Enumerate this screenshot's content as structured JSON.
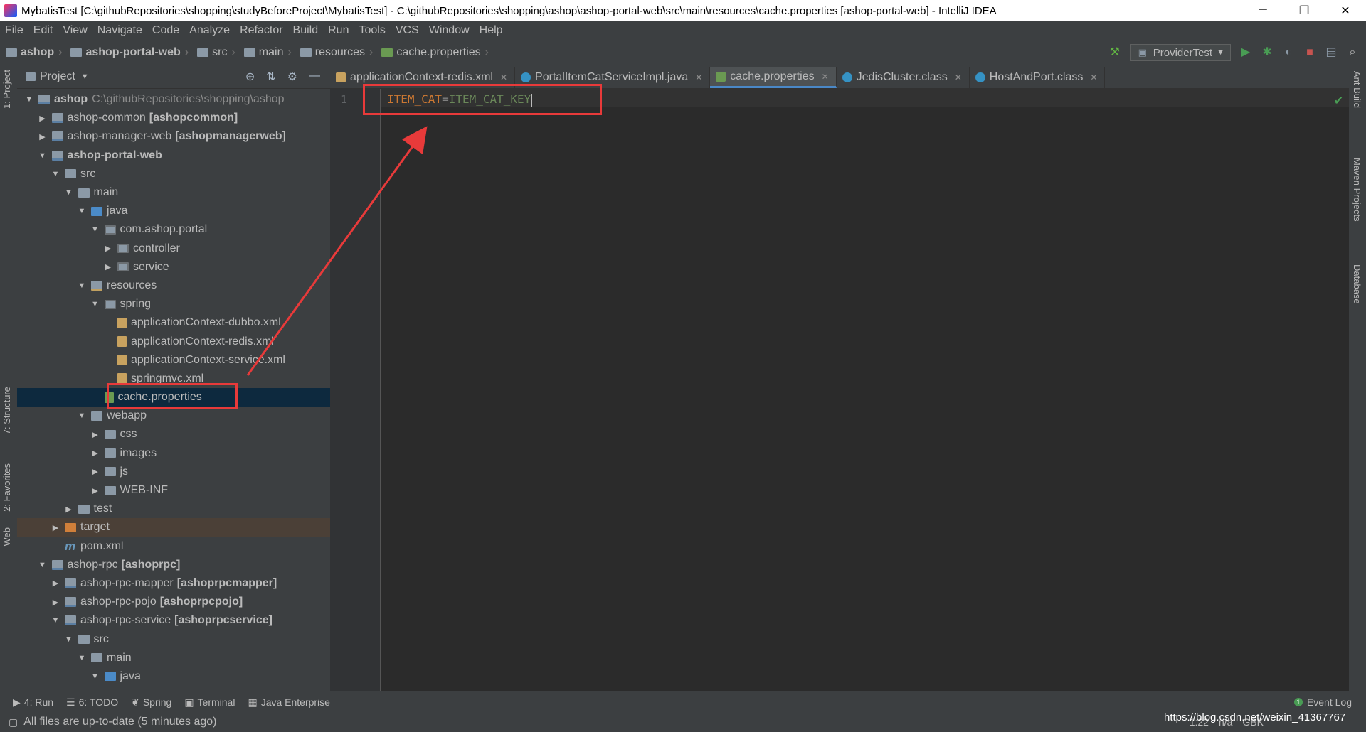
{
  "window": {
    "title": "MybatisTest [C:\\githubRepositories\\shopping\\studyBeforeProject\\MybatisTest] - C:\\githubRepositories\\shopping\\ashop\\ashop-portal-web\\src\\main\\resources\\cache.properties [ashop-portal-web] - IntelliJ IDEA",
    "minimize": "─",
    "restore": "❐",
    "close": "✕"
  },
  "menu": [
    "File",
    "Edit",
    "View",
    "Navigate",
    "Code",
    "Analyze",
    "Refactor",
    "Build",
    "Run",
    "Tools",
    "VCS",
    "Window",
    "Help"
  ],
  "breadcrumb": [
    "ashop",
    "ashop-portal-web",
    "src",
    "main",
    "resources",
    "cache.properties"
  ],
  "run_config": "ProviderTest",
  "project_panel": {
    "title": "Project",
    "tree": [
      {
        "label": "ashop",
        "path": "C:\\githubRepositories\\shopping\\ashop",
        "bold": true,
        "depth": 0,
        "arrow": "open",
        "icon": "module"
      },
      {
        "label": "ashop-common",
        "tag": "[ashopcommon]",
        "depth": 1,
        "arrow": "closed",
        "icon": "module"
      },
      {
        "label": "ashop-manager-web",
        "tag": "[ashopmanagerweb]",
        "depth": 1,
        "arrow": "closed",
        "icon": "module"
      },
      {
        "label": "ashop-portal-web",
        "bold": true,
        "depth": 1,
        "arrow": "open",
        "icon": "module"
      },
      {
        "label": "src",
        "depth": 2,
        "arrow": "open",
        "icon": "folder"
      },
      {
        "label": "main",
        "depth": 3,
        "arrow": "open",
        "icon": "folder"
      },
      {
        "label": "java",
        "depth": 4,
        "arrow": "open",
        "icon": "src"
      },
      {
        "label": "com.ashop.portal",
        "depth": 5,
        "arrow": "open",
        "icon": "pkg"
      },
      {
        "label": "controller",
        "depth": 6,
        "arrow": "closed",
        "icon": "pkg"
      },
      {
        "label": "service",
        "depth": 6,
        "arrow": "closed",
        "icon": "pkg"
      },
      {
        "label": "resources",
        "depth": 4,
        "arrow": "open",
        "icon": "res"
      },
      {
        "label": "spring",
        "depth": 5,
        "arrow": "open",
        "icon": "pkg"
      },
      {
        "label": "applicationContext-dubbo.xml",
        "depth": 6,
        "arrow": "none",
        "icon": "xml"
      },
      {
        "label": "applicationContext-redis.xml",
        "depth": 6,
        "arrow": "none",
        "icon": "xml"
      },
      {
        "label": "applicationContext-service.xml",
        "depth": 6,
        "arrow": "none",
        "icon": "xml"
      },
      {
        "label": "springmvc.xml",
        "depth": 6,
        "arrow": "none",
        "icon": "xml"
      },
      {
        "label": "cache.properties",
        "depth": 5,
        "arrow": "none",
        "icon": "props",
        "selected": true
      },
      {
        "label": "webapp",
        "depth": 4,
        "arrow": "open",
        "icon": "folder"
      },
      {
        "label": "css",
        "depth": 5,
        "arrow": "closed",
        "icon": "folder"
      },
      {
        "label": "images",
        "depth": 5,
        "arrow": "closed",
        "icon": "folder"
      },
      {
        "label": "js",
        "depth": 5,
        "arrow": "closed",
        "icon": "folder"
      },
      {
        "label": "WEB-INF",
        "depth": 5,
        "arrow": "closed",
        "icon": "folder"
      },
      {
        "label": "test",
        "depth": 3,
        "arrow": "closed",
        "icon": "folder"
      },
      {
        "label": "target",
        "depth": 2,
        "arrow": "closed",
        "icon": "target",
        "excluded": true
      },
      {
        "label": "pom.xml",
        "depth": 2,
        "arrow": "none",
        "icon": "maven"
      },
      {
        "label": "ashop-rpc",
        "tag": "[ashoprpc]",
        "depth": 1,
        "arrow": "open",
        "icon": "module"
      },
      {
        "label": "ashop-rpc-mapper",
        "tag": "[ashoprpcmapper]",
        "depth": 2,
        "arrow": "closed",
        "icon": "module"
      },
      {
        "label": "ashop-rpc-pojo",
        "tag": "[ashoprpcpojo]",
        "depth": 2,
        "arrow": "closed",
        "icon": "module"
      },
      {
        "label": "ashop-rpc-service",
        "tag": "[ashoprpcservice]",
        "depth": 2,
        "arrow": "open",
        "icon": "module"
      },
      {
        "label": "src",
        "depth": 3,
        "arrow": "open",
        "icon": "folder"
      },
      {
        "label": "main",
        "depth": 4,
        "arrow": "open",
        "icon": "folder"
      },
      {
        "label": "java",
        "depth": 5,
        "arrow": "open",
        "icon": "src"
      }
    ]
  },
  "tabs": [
    {
      "label": "applicationContext-redis.xml",
      "icon": "xml",
      "active": false
    },
    {
      "label": "PortalItemCatServiceImpl.java",
      "icon": "java",
      "active": false
    },
    {
      "label": "cache.properties",
      "icon": "props",
      "active": true
    },
    {
      "label": "JedisCluster.class",
      "icon": "java",
      "active": false
    },
    {
      "label": "HostAndPort.class",
      "icon": "java",
      "active": false
    }
  ],
  "editor": {
    "line_number": "1",
    "key": "ITEM_CAT",
    "eq": "=",
    "value": "ITEM_CAT_KEY"
  },
  "left_strip": {
    "project": "1: Project",
    "structure": "7: Structure",
    "favorites": "2: Favorites",
    "web": "Web"
  },
  "right_strip": {
    "ant": "Ant Build",
    "maven": "Maven Projects",
    "database": "Database"
  },
  "bottom_tools": [
    "4: Run",
    "6: TODO",
    "Spring",
    "Terminal",
    "Java Enterprise"
  ],
  "event_log": "Event Log",
  "status": {
    "message": "All files are up-to-date (5 minutes ago)",
    "position": "1:22",
    "na": "n/a",
    "encoding": "GBK"
  },
  "watermark": "https://blog.csdn.net/weixin_41367767"
}
